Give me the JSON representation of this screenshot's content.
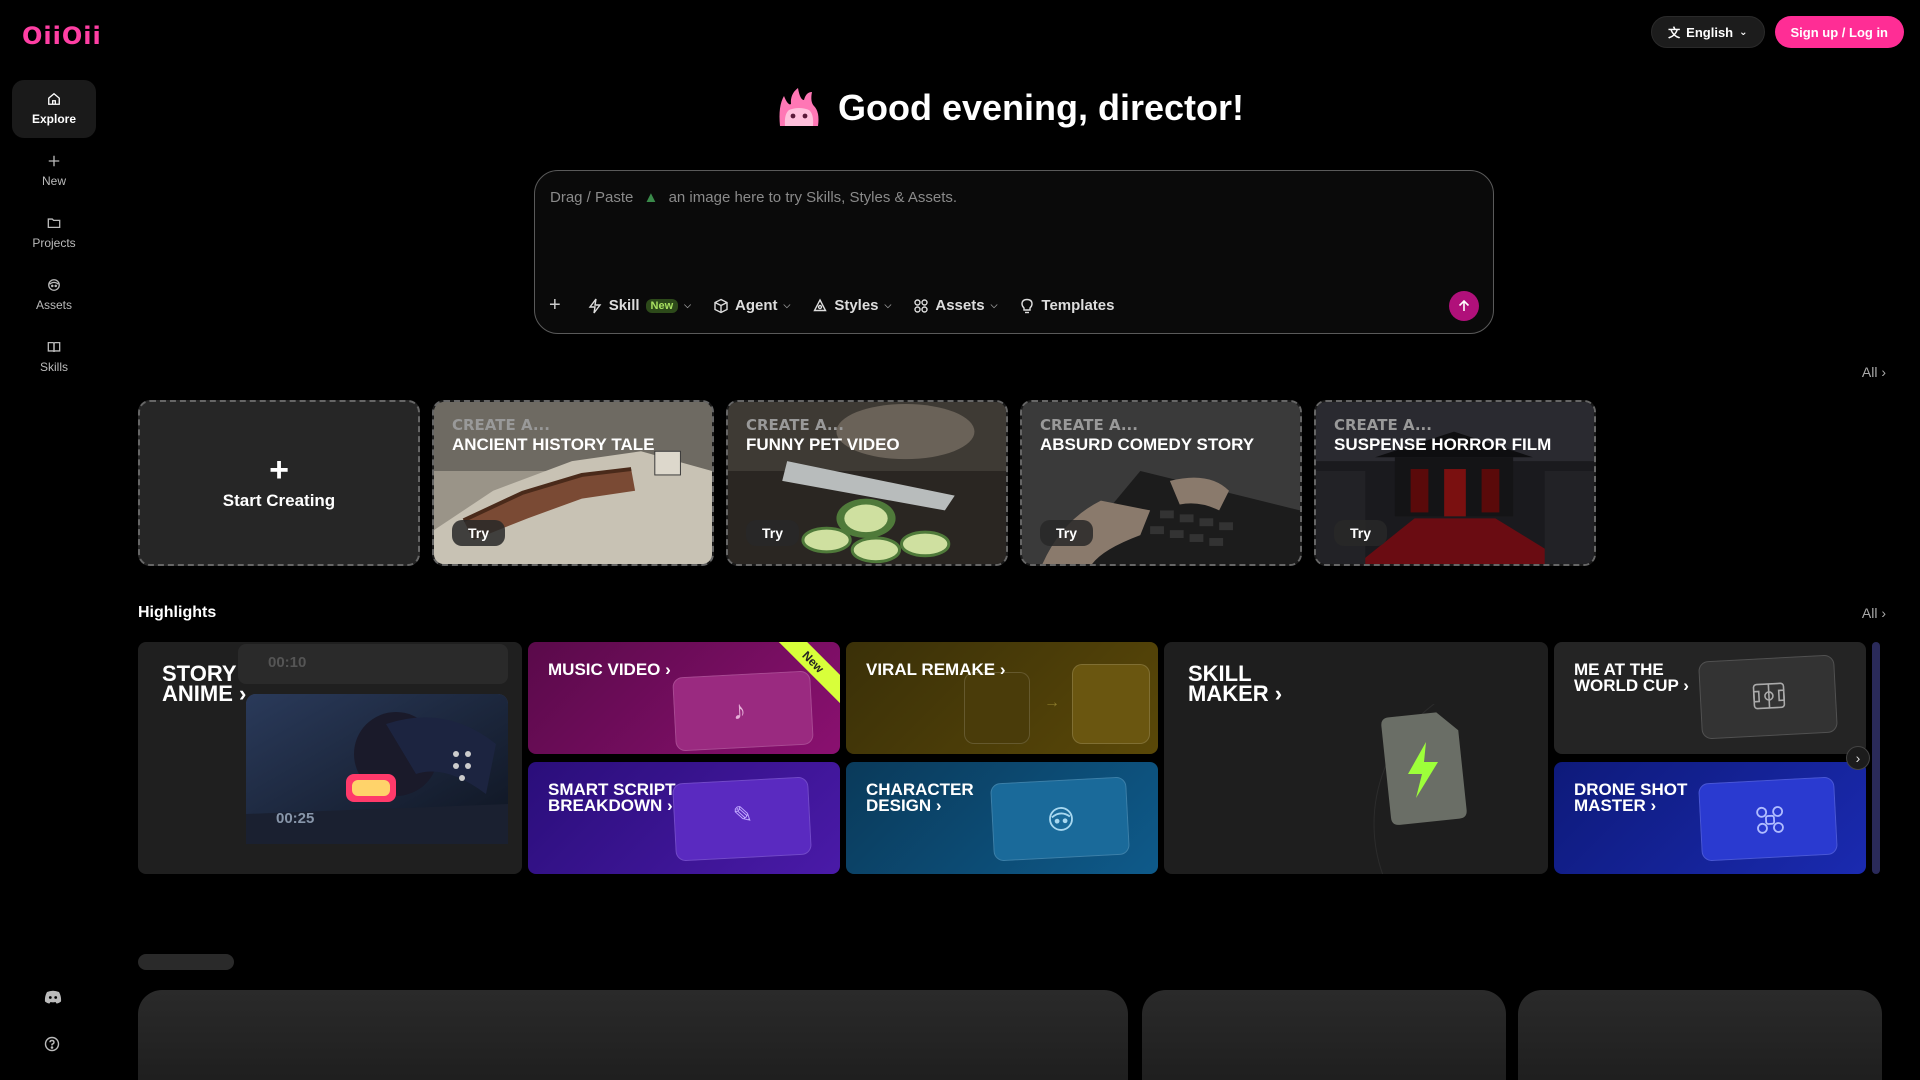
{
  "app": {
    "logo": "OiiOii"
  },
  "topbar": {
    "language_label": "English",
    "signup_label": "Sign up / Log in"
  },
  "sidebar": {
    "items": [
      {
        "label": "Explore",
        "icon": "home-icon",
        "active": true
      },
      {
        "label": "New",
        "icon": "plus-icon"
      },
      {
        "label": "Projects",
        "icon": "folder-icon"
      },
      {
        "label": "Assets",
        "icon": "character-icon"
      },
      {
        "label": "Skills",
        "icon": "book-icon"
      }
    ],
    "bottom_icons": [
      "discord-icon",
      "help-icon"
    ]
  },
  "greeting": "Good evening, director!",
  "prompt": {
    "placeholder_a": "Drag / Paste",
    "placeholder_b": "an image here to try Skills, Styles & Assets.",
    "tools": {
      "skill": "Skill",
      "skill_badge": "New",
      "agent": "Agent",
      "styles": "Styles",
      "assets": "Assets",
      "templates": "Templates"
    }
  },
  "create": {
    "all_label": "All",
    "start_label": "Start Creating",
    "kicker": "CREATE A...",
    "try_label": "Try",
    "cards": [
      {
        "title": "ANCIENT HISTORY TALE"
      },
      {
        "title": "FUNNY PET VIDEO"
      },
      {
        "title": "ABSURD COMEDY STORY"
      },
      {
        "title": "SUSPENSE HORROR FILM"
      }
    ]
  },
  "highlights": {
    "title": "Highlights",
    "all_label": "All",
    "story_anime": {
      "line1": "STORY",
      "line2": "ANIME",
      "time_top": "00:10",
      "time_bottom": "00:25"
    },
    "music_video": {
      "label": "MUSIC VIDEO",
      "ribbon": "New"
    },
    "viral_remake": {
      "label": "VIRAL REMAKE"
    },
    "skill_maker": {
      "line1": "SKILL",
      "line2": "MAKER"
    },
    "world_cup": {
      "line1": "ME AT THE",
      "line2": "WORLD CUP"
    },
    "smart_script": {
      "line1": "SMART SCRIPT",
      "line2": "BREAKDOWN"
    },
    "character_design": {
      "line1": "CHARACTER",
      "line2": "DESIGN"
    },
    "drone_shot": {
      "line1": "DRONE SHOT",
      "line2": "MASTER"
    }
  },
  "colors": {
    "accent": "#ff2d95",
    "send": "#b0107a"
  }
}
